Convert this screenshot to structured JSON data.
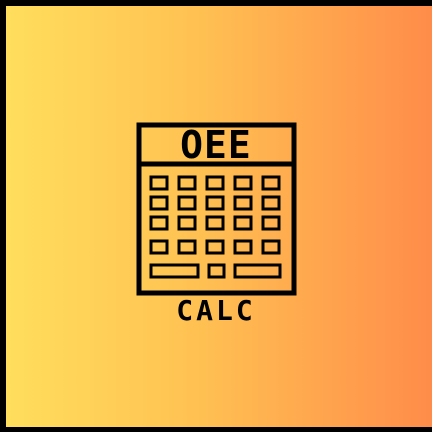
{
  "logo": {
    "display_label": "OEE",
    "caption_label": "CALC",
    "icon": "calculator-icon"
  },
  "colors": {
    "frame": "#000000",
    "gradient_left": "#ffde5c",
    "gradient_mid": "#ffc152",
    "gradient_right": "#ff8c4a",
    "ink": "#000000"
  }
}
